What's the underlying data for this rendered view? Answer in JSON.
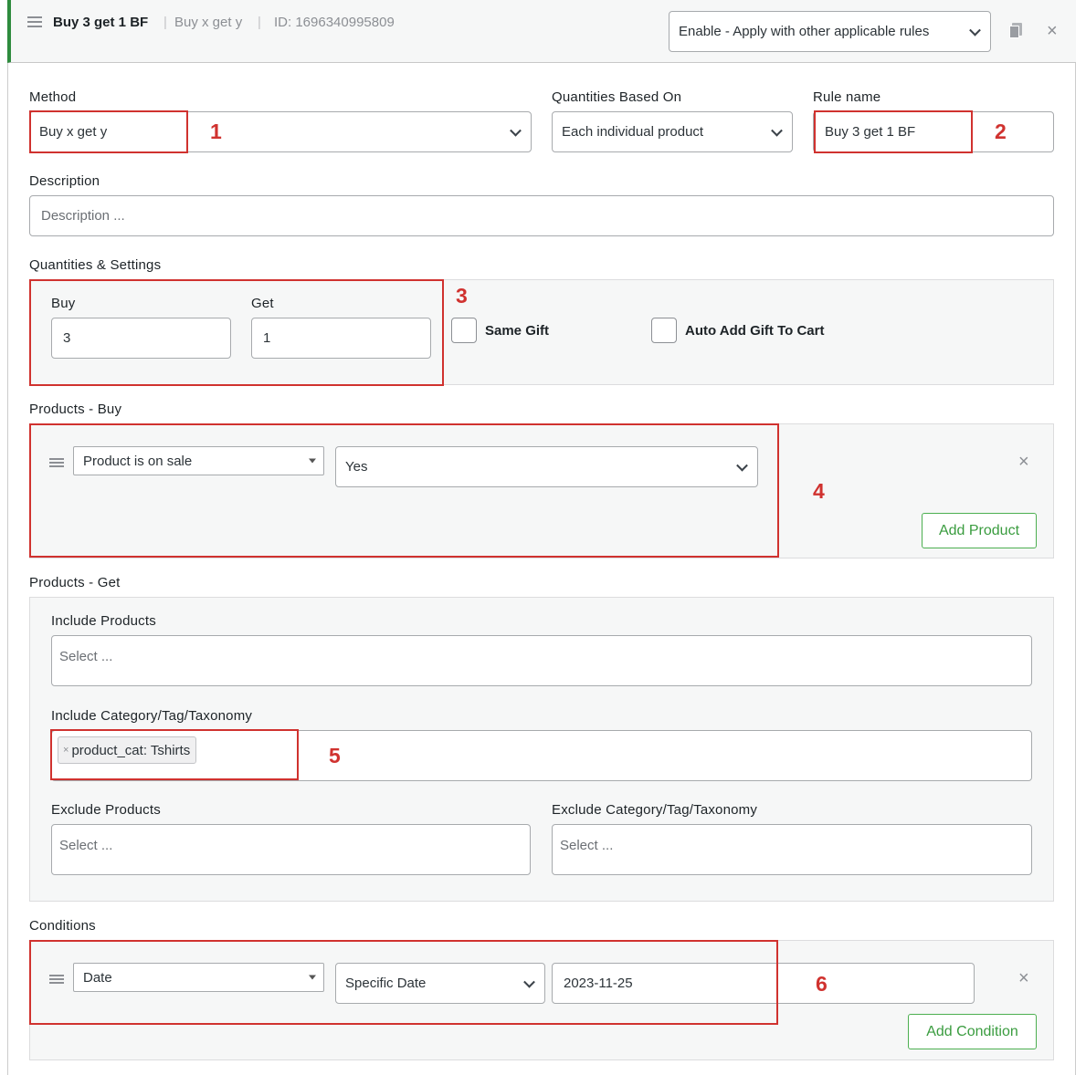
{
  "header": {
    "rule_title": "Buy 3 get 1 BF",
    "rule_type": "Buy x get y",
    "rule_id": "ID: 1696340995809",
    "separator": "|",
    "mode_select": "Enable - Apply with other applicable rules",
    "icons": [
      "hamburger-icon",
      "copy-icon",
      "close-icon"
    ]
  },
  "form": {
    "method": {
      "label": "Method",
      "value": "Buy x get y"
    },
    "quantities_based_on": {
      "label": "Quantities Based On",
      "value": "Each individual product"
    },
    "rule_name": {
      "label": "Rule name",
      "value": "Buy 3 get 1 BF"
    },
    "description": {
      "label": "Description",
      "placeholder": "Description ..."
    }
  },
  "quantities": {
    "label": "Quantities & Settings",
    "buy_label": "Buy",
    "buy_value": "3",
    "get_label": "Get",
    "get_value": "1",
    "same_gift": {
      "label": "Same Gift",
      "checked": false
    },
    "auto_add": {
      "label": "Auto Add Gift To Cart",
      "checked": false
    }
  },
  "products_buy": {
    "label": "Products - Buy",
    "filter_type": "Product is on sale",
    "filter_value": "Yes",
    "add_button": "Add Product"
  },
  "products_get": {
    "label": "Products - Get",
    "include_products": {
      "label": "Include Products",
      "placeholder": "Select ..."
    },
    "include_category": {
      "label": "Include Category/Tag/Taxonomy",
      "tag_remove": "×",
      "tag": "product_cat: Tshirts"
    },
    "exclude_products": {
      "label": "Exclude Products",
      "placeholder": "Select ..."
    },
    "exclude_category": {
      "label": "Exclude Category/Tag/Taxonomy",
      "placeholder": "Select ..."
    }
  },
  "conditions": {
    "label": "Conditions",
    "type": "Date",
    "operator": "Specific Date",
    "value": "2023-11-25",
    "add_button": "Add Condition"
  },
  "annotations": [
    "1",
    "2",
    "3",
    "4",
    "5",
    "6"
  ],
  "colors": {
    "accent_green": "#2e8b3e",
    "annotation_red": "#d0322f"
  }
}
